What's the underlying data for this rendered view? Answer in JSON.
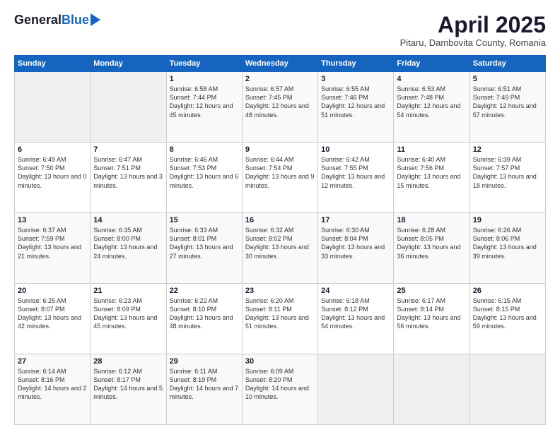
{
  "logo": {
    "general": "General",
    "blue": "Blue"
  },
  "header": {
    "title": "April 2025",
    "subtitle": "Pitaru, Dambovita County, Romania"
  },
  "days_of_week": [
    "Sunday",
    "Monday",
    "Tuesday",
    "Wednesday",
    "Thursday",
    "Friday",
    "Saturday"
  ],
  "weeks": [
    [
      {
        "day": "",
        "empty": true
      },
      {
        "day": "",
        "empty": true
      },
      {
        "day": "1",
        "sunrise": "Sunrise: 6:58 AM",
        "sunset": "Sunset: 7:44 PM",
        "daylight": "Daylight: 12 hours and 45 minutes."
      },
      {
        "day": "2",
        "sunrise": "Sunrise: 6:57 AM",
        "sunset": "Sunset: 7:45 PM",
        "daylight": "Daylight: 12 hours and 48 minutes."
      },
      {
        "day": "3",
        "sunrise": "Sunrise: 6:55 AM",
        "sunset": "Sunset: 7:46 PM",
        "daylight": "Daylight: 12 hours and 51 minutes."
      },
      {
        "day": "4",
        "sunrise": "Sunrise: 6:53 AM",
        "sunset": "Sunset: 7:48 PM",
        "daylight": "Daylight: 12 hours and 54 minutes."
      },
      {
        "day": "5",
        "sunrise": "Sunrise: 6:51 AM",
        "sunset": "Sunset: 7:49 PM",
        "daylight": "Daylight: 12 hours and 57 minutes."
      }
    ],
    [
      {
        "day": "6",
        "sunrise": "Sunrise: 6:49 AM",
        "sunset": "Sunset: 7:50 PM",
        "daylight": "Daylight: 13 hours and 0 minutes."
      },
      {
        "day": "7",
        "sunrise": "Sunrise: 6:47 AM",
        "sunset": "Sunset: 7:51 PM",
        "daylight": "Daylight: 13 hours and 3 minutes."
      },
      {
        "day": "8",
        "sunrise": "Sunrise: 6:46 AM",
        "sunset": "Sunset: 7:53 PM",
        "daylight": "Daylight: 13 hours and 6 minutes."
      },
      {
        "day": "9",
        "sunrise": "Sunrise: 6:44 AM",
        "sunset": "Sunset: 7:54 PM",
        "daylight": "Daylight: 13 hours and 9 minutes."
      },
      {
        "day": "10",
        "sunrise": "Sunrise: 6:42 AM",
        "sunset": "Sunset: 7:55 PM",
        "daylight": "Daylight: 13 hours and 12 minutes."
      },
      {
        "day": "11",
        "sunrise": "Sunrise: 6:40 AM",
        "sunset": "Sunset: 7:56 PM",
        "daylight": "Daylight: 13 hours and 15 minutes."
      },
      {
        "day": "12",
        "sunrise": "Sunrise: 6:39 AM",
        "sunset": "Sunset: 7:57 PM",
        "daylight": "Daylight: 13 hours and 18 minutes."
      }
    ],
    [
      {
        "day": "13",
        "sunrise": "Sunrise: 6:37 AM",
        "sunset": "Sunset: 7:59 PM",
        "daylight": "Daylight: 13 hours and 21 minutes."
      },
      {
        "day": "14",
        "sunrise": "Sunrise: 6:35 AM",
        "sunset": "Sunset: 8:00 PM",
        "daylight": "Daylight: 13 hours and 24 minutes."
      },
      {
        "day": "15",
        "sunrise": "Sunrise: 6:33 AM",
        "sunset": "Sunset: 8:01 PM",
        "daylight": "Daylight: 13 hours and 27 minutes."
      },
      {
        "day": "16",
        "sunrise": "Sunrise: 6:32 AM",
        "sunset": "Sunset: 8:02 PM",
        "daylight": "Daylight: 13 hours and 30 minutes."
      },
      {
        "day": "17",
        "sunrise": "Sunrise: 6:30 AM",
        "sunset": "Sunset: 8:04 PM",
        "daylight": "Daylight: 13 hours and 33 minutes."
      },
      {
        "day": "18",
        "sunrise": "Sunrise: 6:28 AM",
        "sunset": "Sunset: 8:05 PM",
        "daylight": "Daylight: 13 hours and 36 minutes."
      },
      {
        "day": "19",
        "sunrise": "Sunrise: 6:26 AM",
        "sunset": "Sunset: 8:06 PM",
        "daylight": "Daylight: 13 hours and 39 minutes."
      }
    ],
    [
      {
        "day": "20",
        "sunrise": "Sunrise: 6:25 AM",
        "sunset": "Sunset: 8:07 PM",
        "daylight": "Daylight: 13 hours and 42 minutes."
      },
      {
        "day": "21",
        "sunrise": "Sunrise: 6:23 AM",
        "sunset": "Sunset: 8:09 PM",
        "daylight": "Daylight: 13 hours and 45 minutes."
      },
      {
        "day": "22",
        "sunrise": "Sunrise: 6:22 AM",
        "sunset": "Sunset: 8:10 PM",
        "daylight": "Daylight: 13 hours and 48 minutes."
      },
      {
        "day": "23",
        "sunrise": "Sunrise: 6:20 AM",
        "sunset": "Sunset: 8:11 PM",
        "daylight": "Daylight: 13 hours and 51 minutes."
      },
      {
        "day": "24",
        "sunrise": "Sunrise: 6:18 AM",
        "sunset": "Sunset: 8:12 PM",
        "daylight": "Daylight: 13 hours and 54 minutes."
      },
      {
        "day": "25",
        "sunrise": "Sunrise: 6:17 AM",
        "sunset": "Sunset: 8:14 PM",
        "daylight": "Daylight: 13 hours and 56 minutes."
      },
      {
        "day": "26",
        "sunrise": "Sunrise: 6:15 AM",
        "sunset": "Sunset: 8:15 PM",
        "daylight": "Daylight: 13 hours and 59 minutes."
      }
    ],
    [
      {
        "day": "27",
        "sunrise": "Sunrise: 6:14 AM",
        "sunset": "Sunset: 8:16 PM",
        "daylight": "Daylight: 14 hours and 2 minutes."
      },
      {
        "day": "28",
        "sunrise": "Sunrise: 6:12 AM",
        "sunset": "Sunset: 8:17 PM",
        "daylight": "Daylight: 14 hours and 5 minutes."
      },
      {
        "day": "29",
        "sunrise": "Sunrise: 6:11 AM",
        "sunset": "Sunset: 8:19 PM",
        "daylight": "Daylight: 14 hours and 7 minutes."
      },
      {
        "day": "30",
        "sunrise": "Sunrise: 6:09 AM",
        "sunset": "Sunset: 8:20 PM",
        "daylight": "Daylight: 14 hours and 10 minutes."
      },
      {
        "day": "",
        "empty": true
      },
      {
        "day": "",
        "empty": true
      },
      {
        "day": "",
        "empty": true
      }
    ]
  ]
}
